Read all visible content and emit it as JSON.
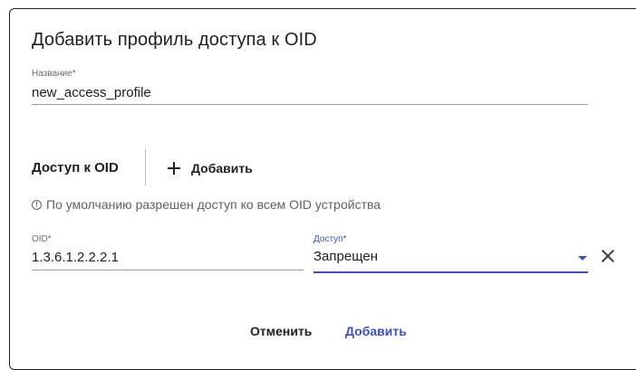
{
  "dialog": {
    "title": "Добавить профиль доступа к OID"
  },
  "name_field": {
    "label": "Название*",
    "value": "new_access_profile"
  },
  "oid_section": {
    "title": "Доступ к OID",
    "add_label": "Добавить",
    "hint": "По умолчанию разрешен доступ ко всем OID устройства"
  },
  "oid_row": {
    "oid_label": "OID*",
    "oid_value": "1.3.6.1.2.2.2.1",
    "access_label": "Доступ*",
    "access_value": "Запрещен"
  },
  "actions": {
    "cancel": "Отменить",
    "submit": "Добавить"
  },
  "colors": {
    "accent": "#3f51b5",
    "text": "#212121"
  },
  "icons": [
    "plus-icon",
    "info-icon",
    "caret-down-icon",
    "close-icon"
  ]
}
